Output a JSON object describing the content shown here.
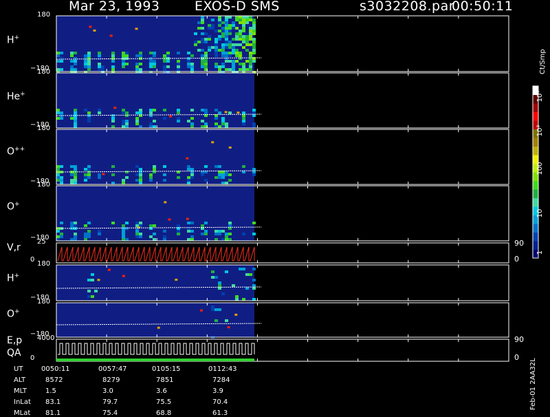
{
  "header": {
    "date": "Mar 23, 1993",
    "instrument": "EXOS-D SMS",
    "file": "s3032208.par",
    "time": "00:50:11"
  },
  "colorbar": {
    "unit": "Ct/Smp",
    "tick_labels": [
      "1",
      "10",
      "100",
      "10³",
      "10⁴"
    ],
    "colors": [
      "#000070",
      "#00208c",
      "#0040b0",
      "#0070c8",
      "#00a0d8",
      "#00c8e0",
      "#40d8a0",
      "#20b040",
      "#40d820",
      "#80e000",
      "#c0f000",
      "#f0f000",
      "#c0b000",
      "#a08000",
      "#807000",
      "#c00000",
      "#ff0000",
      "#a00000",
      "#600000",
      "#ffffff"
    ]
  },
  "side_label": "Feb-01 2AA32L",
  "chart_data": [
    {
      "type": "heatmap",
      "panel": "H+",
      "label": "H",
      "charge": "+",
      "y_range": [
        -180,
        180
      ],
      "y_ticks": [
        "180",
        "−180"
      ],
      "active_x_range": [
        0,
        0.63
      ]
    },
    {
      "type": "heatmap",
      "panel": "He+",
      "label": "He",
      "charge": "+",
      "y_range": [
        -180,
        180
      ],
      "y_ticks": [
        "180",
        "−180"
      ],
      "active_x_range": [
        0,
        0.63
      ]
    },
    {
      "type": "heatmap",
      "panel": "O++",
      "label": "O",
      "charge": "++",
      "y_range": [
        -180,
        180
      ],
      "y_ticks": [
        "180",
        "−180"
      ],
      "active_x_range": [
        0,
        0.63
      ]
    },
    {
      "type": "heatmap",
      "panel": "O+",
      "label": "O",
      "charge": "+",
      "y_range": [
        -180,
        180
      ],
      "y_ticks": [
        "180",
        "−180"
      ],
      "active_x_range": [
        0,
        0.63
      ]
    },
    {
      "type": "line",
      "panel": "V,r",
      "label": "V,r",
      "y_ticks": [
        "25",
        "0"
      ],
      "right_ticks": [
        "90",
        "0"
      ],
      "series_color": "#ff3020"
    },
    {
      "type": "heatmap",
      "panel": "H+ (2)",
      "label": "H",
      "charge": "+",
      "y_range": [
        -180,
        180
      ],
      "y_ticks": [
        "180",
        "−180"
      ],
      "active_x_range": [
        0,
        0.63
      ]
    },
    {
      "type": "heatmap",
      "panel": "O+ (2)",
      "label": "O",
      "charge": "+",
      "y_range": [
        -180,
        180
      ],
      "y_ticks": [
        "180",
        "−180"
      ],
      "active_x_range": [
        0,
        0.63
      ]
    },
    {
      "type": "line",
      "panel": "E,p QA",
      "label": "E,p",
      "label2": "QA",
      "y_ticks": [
        "4000",
        "0"
      ],
      "right_ticks": [
        "90",
        "0"
      ],
      "series_color": "#ffffff",
      "qa_color": "#30d030"
    }
  ],
  "ephemeris": {
    "labels": [
      "UT",
      "ALT",
      "MLT",
      "InLat",
      "MLat"
    ],
    "columns": [
      [
        "0050:11",
        "8572",
        "1.5",
        "83.1",
        "81.1"
      ],
      [
        "0057:47",
        "8279",
        "3.0",
        "79.7",
        "75.4"
      ],
      [
        "0105:15",
        "7851",
        "3.6",
        "75.5",
        "68.8"
      ],
      [
        "0112:43",
        "7284",
        "3.9",
        "70.4",
        "61.3"
      ]
    ]
  }
}
